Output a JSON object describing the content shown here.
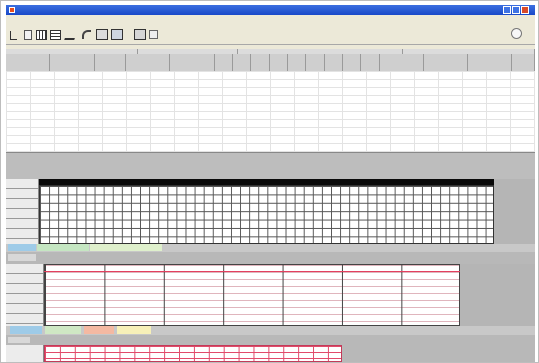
{
  "window": {
    "title": "",
    "colors": {
      "titlebar": "#2458d4",
      "chrome": "#ece9d8",
      "workspace": "#c0c0c0",
      "close": "#d84a2a"
    }
  },
  "menu": {
    "items": []
  },
  "toolbar": {
    "icons": [
      "cursor-icon",
      "pan-icon",
      "table-icon",
      "grid-icon",
      "cut-icon",
      "undo-icon",
      "print-icon",
      "preview-icon",
      "export-icon",
      "settings-icon"
    ]
  },
  "top_table": {
    "group_headers": [],
    "columns": [],
    "rows": []
  },
  "schedule": {
    "date_title": "",
    "time_ticks": []
  },
  "grid1": {
    "row_labels": [],
    "highlight_color": "#000000"
  },
  "legend1": {
    "colors": [
      "#9ecbe8",
      "#c5e6c2",
      "#dff0cc"
    ]
  },
  "grid2": {
    "header": "",
    "columns": [],
    "row_labels": [],
    "accent_color": "#e3405e"
  },
  "legend2": {
    "colors": [
      "#9ecbe8",
      "#cfe8c4",
      "#f4b9a2",
      "#f7f0b8"
    ]
  },
  "grid3": {
    "header": "",
    "row_labels": [],
    "line_color": "#e14a6a"
  }
}
